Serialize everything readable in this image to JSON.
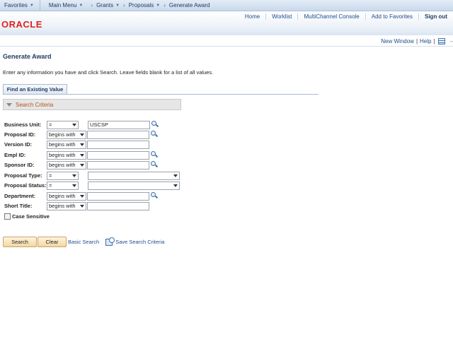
{
  "topnav": {
    "favorites": "Favorites",
    "main_menu": "Main Menu",
    "breadcrumbs": [
      "Grants",
      "Proposals",
      "Generate Award"
    ]
  },
  "header": {
    "logo": "ORACLE",
    "links": {
      "home": "Home",
      "worklist": "Worklist",
      "multichannel": "MultiChannel Console",
      "add_favorites": "Add to Favorites",
      "signout": "Sign out"
    },
    "new_window": "New Window",
    "help": "Help"
  },
  "page": {
    "title": "Generate Award",
    "instructions": "Enter any information you have and click Search. Leave fields blank for a list of all values.",
    "tab": "Find an Existing Value",
    "section": "Search Criteria"
  },
  "form": {
    "business_unit": {
      "label": "Business Unit:",
      "op": "=",
      "value": "USCSP"
    },
    "proposal_id": {
      "label": "Proposal ID:",
      "op": "begins with",
      "value": ""
    },
    "version_id": {
      "label": "Version ID:",
      "op": "begins with",
      "value": ""
    },
    "empl_id": {
      "label": "Empl ID:",
      "op": "begins with",
      "value": ""
    },
    "sponsor_id": {
      "label": "Sponsor ID:",
      "op": "begins with",
      "value": ""
    },
    "proposal_type": {
      "label": "Proposal Type:",
      "op": "=",
      "value": ""
    },
    "proposal_status": {
      "label": "Proposal Status:",
      "op": "=",
      "value": ""
    },
    "department": {
      "label": "Department:",
      "op": "begins with",
      "value": ""
    },
    "short_title": {
      "label": "Short Title:",
      "op": "begins with",
      "value": ""
    },
    "case_sensitive": "Case Sensitive"
  },
  "actions": {
    "search": "Search",
    "clear": "Clear",
    "basic_search": "Basic Search",
    "save_search": "Save Search Criteria"
  }
}
